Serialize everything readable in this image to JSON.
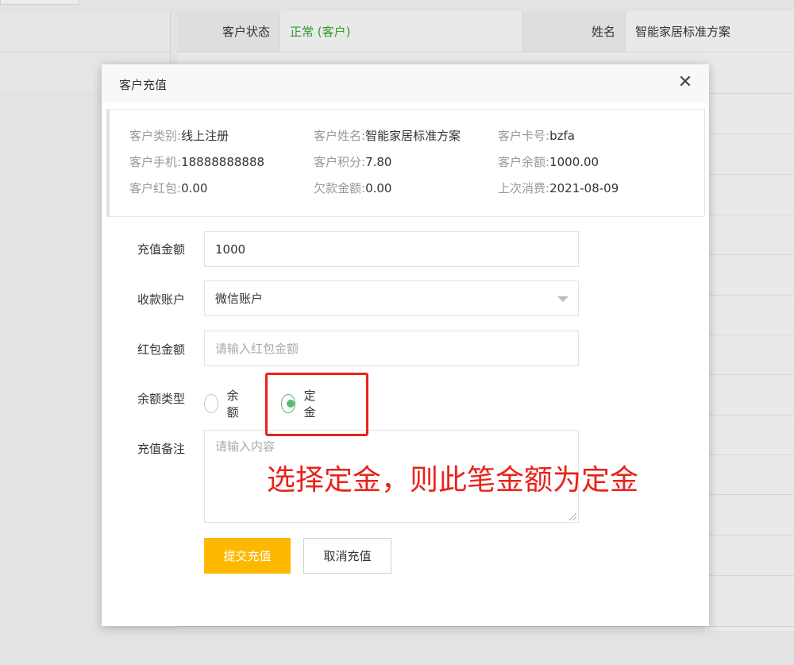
{
  "background_table": {
    "row1": {
      "status_label": "客户状态",
      "status_value": "正常 (客户)",
      "name_label": "姓名",
      "name_value": "智能家居标准方案"
    }
  },
  "modal": {
    "title": "客户充值",
    "close_icon": "close-icon",
    "customer_info": {
      "category_label": "客户类别:",
      "category_value": "线上注册",
      "name_label": "客户姓名:",
      "name_value": "智能家居标准方案",
      "card_label": "客户卡号:",
      "card_value": "bzfa",
      "phone_label": "客户手机:",
      "phone_value": "18888888888",
      "points_label": "客户积分:",
      "points_value": "7.80",
      "balance_label": "客户余额:",
      "balance_value": "1000.00",
      "redpacket_label": "客户红包:",
      "redpacket_value": "0.00",
      "debt_label": "欠款金额:",
      "debt_value": "0.00",
      "last_purchase_label": "上次消费:",
      "last_purchase_value": "2021-08-09"
    },
    "form": {
      "amount_label": "充值金额",
      "amount_value": "1000",
      "account_label": "收款账户",
      "account_value": "微信账户",
      "redpacket_label": "红包金额",
      "redpacket_placeholder": "请输入红包金额",
      "balance_type_label": "余额类型",
      "balance_type_options": [
        "余额",
        "定金"
      ],
      "balance_type_selected": "定金",
      "remark_label": "充值备注",
      "remark_placeholder": "请输入内容"
    },
    "buttons": {
      "submit": "提交充值",
      "cancel": "取消充值"
    }
  },
  "annotation": {
    "text": "选择定金，则此笔金额为定金",
    "color": "#e8231b"
  },
  "colors": {
    "submit_button": "#ffb800",
    "radio_selected": "#5fb878",
    "status_text": "#2e9a2e"
  }
}
